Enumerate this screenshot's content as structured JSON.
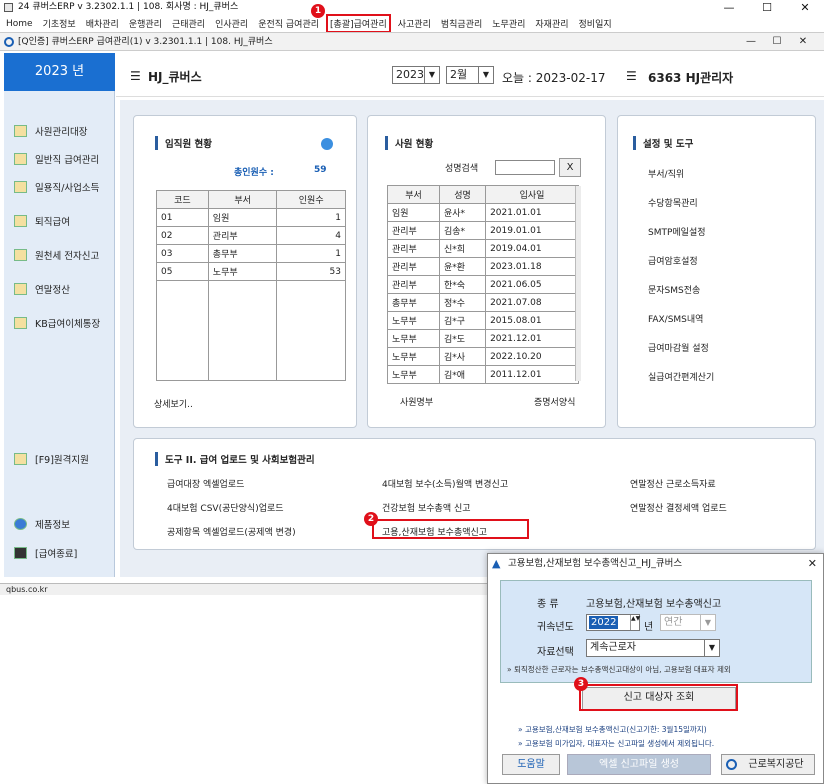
{
  "window": {
    "title": "24 큐버스ERP v 3.2302.1.1  | 108. 회사명 : HJ_큐버스",
    "min": "—",
    "max": "☐",
    "close": "✕"
  },
  "menu": [
    "Home",
    "기초정보",
    "배차관리",
    "운행관리",
    "근태관리",
    "인사관리",
    "운전직 급여관리",
    "[총괄]급여관리",
    "사고관리",
    "범칙금관리",
    "노무관리",
    "자재관리",
    "정비일지"
  ],
  "mdi": {
    "title": "[Q인증] 큐버스ERP    급여관리(1)   v 3.2301.1.1   | 108. HJ_큐버스",
    "min": "—",
    "max": "☐",
    "close": "✕"
  },
  "year_label": "2023 년",
  "header": {
    "company": "HJ_큐버스",
    "year": "2023",
    "month": "2월",
    "today": "오늘 : 2023-02-17",
    "user": "6363 HJ관리자"
  },
  "sidebar": [
    "사원관리대장",
    "일반직 급여관리",
    "일용직/사업소득",
    "퇴직급여",
    "원천세 전자신고",
    "연말정산",
    "KB급여이체통장",
    "[F9]원격지원",
    "제품정보",
    "[급여종료]"
  ],
  "panel1": {
    "title": "임직원 현황",
    "total_label": "총인원수 :",
    "total": "59",
    "cols": [
      "코드",
      "부서",
      "인원수"
    ],
    "rows": [
      [
        "01",
        "임원",
        "1"
      ],
      [
        "02",
        "관리부",
        "4"
      ],
      [
        "03",
        "총무부",
        "1"
      ],
      [
        "05",
        "노무부",
        "53"
      ]
    ],
    "more": "상세보기.."
  },
  "panel2": {
    "title": "사원 현황",
    "search_label": "성명검색",
    "search_value": "",
    "x": "X",
    "cols": [
      "부서",
      "성명",
      "입사일"
    ],
    "rows": [
      [
        "임원",
        "윤사*",
        "2021.01.01"
      ],
      [
        "관리부",
        "김송*",
        "2019.01.01"
      ],
      [
        "관리부",
        "신*희",
        "2019.04.01"
      ],
      [
        "관리부",
        "윤*환",
        "2023.01.18"
      ],
      [
        "관리부",
        "한*숙",
        "2021.06.05"
      ],
      [
        "총무부",
        "정*수",
        "2021.07.08"
      ],
      [
        "노무부",
        "김*구",
        "2015.08.01"
      ],
      [
        "노무부",
        "김*도",
        "2021.12.01"
      ],
      [
        "노무부",
        "김*사",
        "2022.10.20"
      ],
      [
        "노무부",
        "김*애",
        "2011.12.01"
      ]
    ],
    "link1": "사원명부",
    "link2": "증명서양식"
  },
  "panel3": {
    "title": "설정 및 도구",
    "items": [
      "부서/직위",
      "수당항목관리",
      "SMTP메일설정",
      "급여암호설정",
      "문자SMS전송",
      "FAX/SMS내역",
      "급여마감월 설정",
      "실급여간편계산기"
    ]
  },
  "panel4": {
    "title": "도구 II. 급여 업로드 및 사회보험관리",
    "links": [
      "급여대장 엑셀업로드",
      "4대보험 보수(소득)월액 변경신고",
      "연말정산 근로소득자료",
      "4대보험 CSV(공단양식)업로드",
      "건강보험 보수총액 신고",
      "연말정산 결정세액 업로드",
      "공제항목 엑셀업로드(공제액 변경)",
      "고용,산재보험 보수총액신고"
    ]
  },
  "status": "qbus.co.kr",
  "dialog": {
    "title": "고용보험,산재보험 보수총액신고_HJ_큐버스",
    "close": "✕",
    "kind_label": "종    류",
    "kind": "고용보험,산재보험 보수총액신고",
    "year_label": "귀속년도",
    "year": "2022",
    "year_unit": "년",
    "period": "연간",
    "data_label": "자료선택",
    "data": "계속근로자",
    "note1": "퇴직정산한 근로자는 보수총액신고대상이 아님, 고용보험 대표자 제외",
    "search_btn": "신고 대상자 조회",
    "note2": "고용보험,산재보험 보수총액신고(신고기한: 3월15일까지)",
    "note3": "고용보험 미가입자, 대표자는 신고파일 생성에서 제외됩니다.",
    "help": "도움말",
    "excel": "엑셀 신고파일 생성",
    "comwel": "근로복지공단"
  },
  "markers": [
    "1",
    "2",
    "3"
  ]
}
